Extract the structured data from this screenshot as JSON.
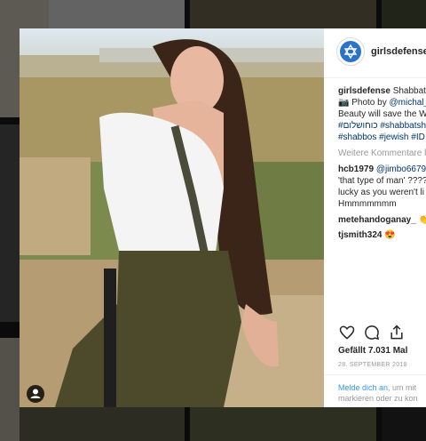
{
  "post": {
    "username": "girlsdefense",
    "caption_user": "girlsdefense",
    "caption_line1": "Shabbat",
    "caption_line2_prefix": "📷 Photo by ",
    "caption_line2_mention": "@michal_",
    "caption_line3": "Beauty will save the W",
    "caption_line4": "#כוחושלום #shabbatsh",
    "caption_line5": "#shabbos #jewish #ID",
    "more_comments": "Weitere Kommentare l",
    "likes": "Gefällt 7.031 Mal",
    "date": "28. SEPTEMBER 2018",
    "login_prefix": "Melde dich an",
    "login_suffix": ", um mit",
    "login_line2": "markieren oder zu kon"
  },
  "comments": [
    {
      "user": "hcb1979",
      "mention": "@jimbo6679",
      "line2": "'that type of man' ????",
      "line3": "lucky as you weren't li",
      "line4": "Hmmmmmmm"
    },
    {
      "user": "metehandoganay_",
      "text": " 👏"
    },
    {
      "user": "tjsmith324",
      "text": " 😍"
    }
  ],
  "icons": {
    "like": "heart-icon",
    "comment": "comment-icon",
    "share": "share-icon",
    "tag": "user-tag-icon",
    "profile": "star-of-david-icon"
  },
  "colors": {
    "link": "#003569",
    "accent": "#3897f0",
    "overlay": "rgba(0,0,0,0.58)"
  }
}
